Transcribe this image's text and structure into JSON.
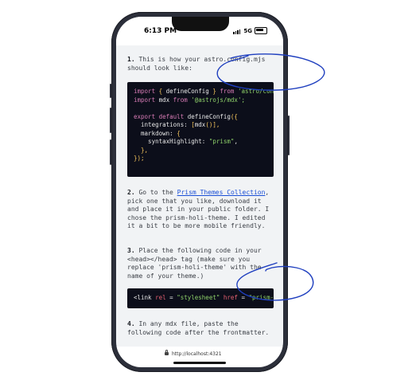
{
  "status_bar": {
    "time": "6:13 PM",
    "network": "5G"
  },
  "steps": [
    {
      "number": "1.",
      "text": " This is how your astro.config.mjs should look like:"
    },
    {
      "number": "2.",
      "text_before": " Go to the ",
      "link": "Prism Themes Collection",
      "text_after": ", pick one that you like, download it and place it in your public folder. I chose the prism-holi-theme. I edited it a bit to be more mobile friendly."
    },
    {
      "number": "3.",
      "text": " Place the following code in your <head></head> tag (make sure you replace 'prism-holi-theme' with the name of your theme.)"
    },
    {
      "number": "4.",
      "text": " In any mdx file, paste the following code after the frontmatter."
    }
  ],
  "code1": {
    "l1_kw": "import",
    "l1_b1": " { ",
    "l1_name": "defineConfig",
    "l1_b2": " } ",
    "l1_kw2": "from",
    "l1_str": " 'astro/config'",
    "l2_kw": "import",
    "l2_name": " mdx ",
    "l2_kw2": "from",
    "l2_str": " '@astrojs/mdx';",
    "l4_kw": "export default",
    "l4_fn": " defineConfig",
    "l4_b": "({",
    "l5_prop": "  integrations: ",
    "l5_b": "[",
    "l5_fn": "mdx",
    "l5_p": "()",
    "l5_b2": "],",
    "l6_prop": "  markdown: ",
    "l6_b": "{",
    "l7_prop": "    syntaxHighlight: ",
    "l7_str": "\"prism\"",
    "l7_comma": ",",
    "l8_b": "  },",
    "l9_b": "});"
  },
  "code2": {
    "tag_open": "<link ",
    "attr": "rel",
    "eq": " = ",
    "val": "\"stylesheet\"",
    "attr2": " href",
    "eq2": " = ",
    "val2": "\"prism-h"
  },
  "url_bar": {
    "url": "http://localhost:4321"
  },
  "annotation": {
    "color": "#1f3fbf"
  }
}
